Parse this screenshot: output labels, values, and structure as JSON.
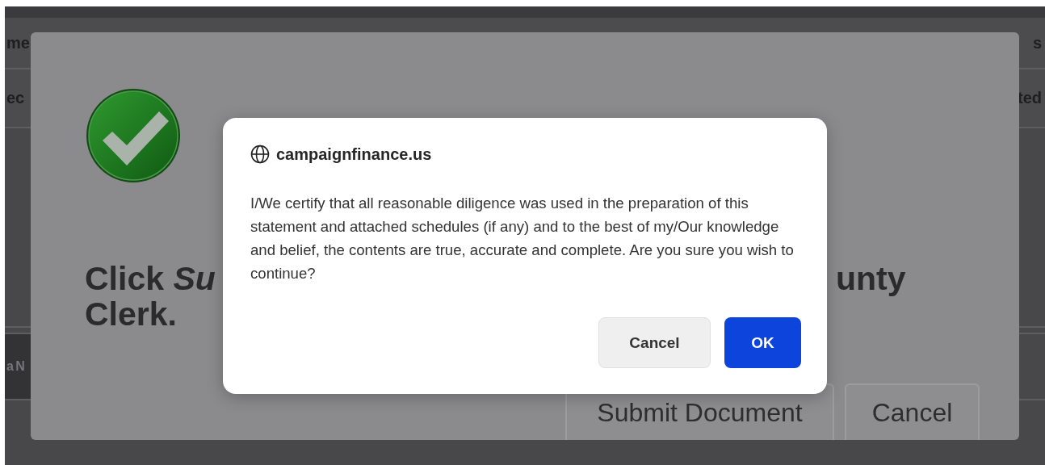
{
  "page": {
    "header_left": "me",
    "header_right": "s",
    "row_left": "ec",
    "row_right": "ted",
    "footer_left": "a N"
  },
  "modal": {
    "heading_left": "Click *Su*",
    "heading_right": "unty",
    "heading_line2": "Clerk.",
    "buttons": [
      {
        "label": "Submit Document",
        "kind": "primary"
      },
      {
        "label": "Cancel",
        "kind": "secondary"
      }
    ]
  },
  "dialog": {
    "site": "campaignfinance.us",
    "message": "I/We certify that all reasonable diligence was used in the preparation of this statement and attached schedules (if any) and to the best of my/Our knowledge and belief, the contents are true, accurate and complete.  Are you sure you wish to continue?",
    "buttons": [
      {
        "label": "Cancel",
        "kind": "secondary"
      },
      {
        "label": "OK",
        "kind": "primary"
      }
    ]
  }
}
